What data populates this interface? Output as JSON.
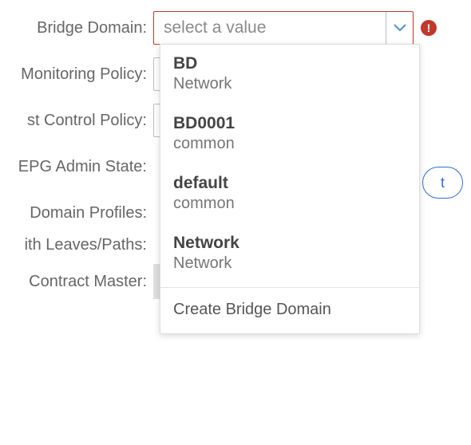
{
  "fields": {
    "bridge_domain": {
      "label": "Bridge Domain:",
      "placeholder": "select a value"
    },
    "monitoring_policy": {
      "label": "Monitoring Policy:"
    },
    "fhs_trust_policy": {
      "label": "st Control Policy:"
    },
    "epg_admin_state": {
      "label": "EPG Admin State:"
    },
    "domain_profiles": {
      "label": "Domain Profiles:"
    },
    "leaves_paths": {
      "label": "ith Leaves/Paths:"
    },
    "contract_master": {
      "label": "Contract Master:"
    }
  },
  "error_badge": "!",
  "pill_button": "t",
  "dropdown": {
    "options": [
      {
        "title": "BD",
        "sub": "Network"
      },
      {
        "title": "BD0001",
        "sub": "common"
      },
      {
        "title": "default",
        "sub": "common"
      },
      {
        "title": "Network",
        "sub": "Network"
      }
    ],
    "create": "Create Bridge Domain"
  }
}
